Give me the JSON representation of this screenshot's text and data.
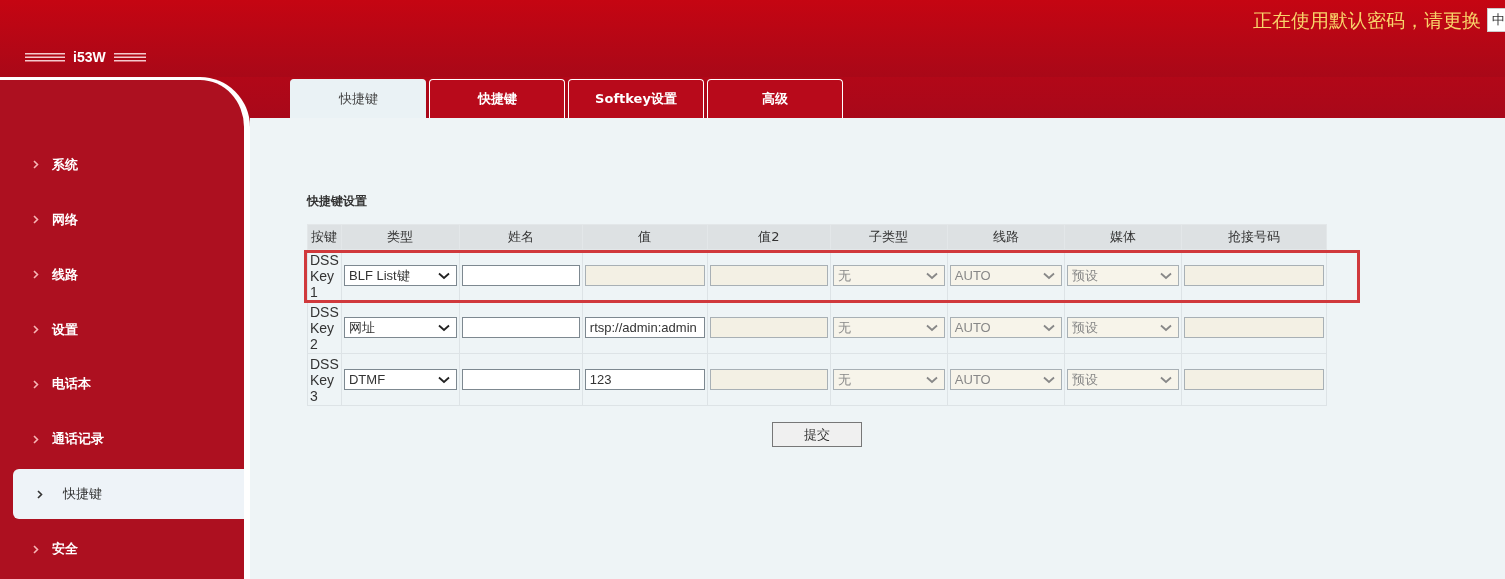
{
  "header": {
    "logo": "i53W",
    "notice": "正在使用默认密码，请更换",
    "language": "中"
  },
  "sidebar": {
    "items": [
      {
        "label": "系统",
        "selected": false
      },
      {
        "label": "网络",
        "selected": false
      },
      {
        "label": "线路",
        "selected": false
      },
      {
        "label": "设置",
        "selected": false
      },
      {
        "label": "电话本",
        "selected": false
      },
      {
        "label": "通话记录",
        "selected": false
      },
      {
        "label": "快捷键",
        "selected": true
      },
      {
        "label": "安全",
        "selected": false
      }
    ]
  },
  "tabs": [
    {
      "label": "快捷键",
      "selected": true
    },
    {
      "label": "快捷键",
      "selected": false
    },
    {
      "label": "Softkey设置",
      "selected": false
    },
    {
      "label": "高级",
      "selected": false
    }
  ],
  "section_title": "快捷键设置",
  "table": {
    "columns": [
      "按键",
      "类型",
      "姓名",
      "值",
      "值2",
      "子类型",
      "线路",
      "媒体",
      "抢接号码"
    ],
    "rows": [
      {
        "highlighted": true,
        "cells": [
          {
            "kind": "text",
            "value": "DSS Key 1"
          },
          {
            "kind": "select",
            "value": "BLF List键",
            "disabled": false
          },
          {
            "kind": "input",
            "disabled": false
          },
          {
            "kind": "input",
            "disabled": true
          },
          {
            "kind": "input",
            "disabled": true
          },
          {
            "kind": "select",
            "value": "无",
            "disabled": true
          },
          {
            "kind": "select",
            "value": "AUTO",
            "disabled": true
          },
          {
            "kind": "select",
            "value": "预设",
            "disabled": true
          },
          {
            "kind": "input",
            "disabled": true
          }
        ]
      },
      {
        "highlighted": false,
        "cells": [
          {
            "kind": "text",
            "value": "DSS Key 2"
          },
          {
            "kind": "select",
            "value": "网址",
            "disabled": false
          },
          {
            "kind": "input",
            "disabled": false
          },
          {
            "kind": "input",
            "value": "rtsp://admin:admin",
            "disabled": false
          },
          {
            "kind": "input",
            "disabled": true
          },
          {
            "kind": "select",
            "value": "无",
            "disabled": true
          },
          {
            "kind": "select",
            "value": "AUTO",
            "disabled": true
          },
          {
            "kind": "select",
            "value": "预设",
            "disabled": true
          },
          {
            "kind": "input",
            "disabled": true
          }
        ]
      },
      {
        "highlighted": false,
        "cells": [
          {
            "kind": "text",
            "value": "DSS Key 3"
          },
          {
            "kind": "select",
            "value": "DTMF",
            "disabled": false
          },
          {
            "kind": "input",
            "disabled": false
          },
          {
            "kind": "input",
            "value": "123",
            "disabled": false
          },
          {
            "kind": "input",
            "disabled": true
          },
          {
            "kind": "select",
            "value": "无",
            "disabled": true
          },
          {
            "kind": "select",
            "value": "AUTO",
            "disabled": true
          },
          {
            "kind": "select",
            "value": "预设",
            "disabled": true
          },
          {
            "kind": "input",
            "disabled": true
          }
        ]
      }
    ]
  },
  "submit_button": "提交"
}
